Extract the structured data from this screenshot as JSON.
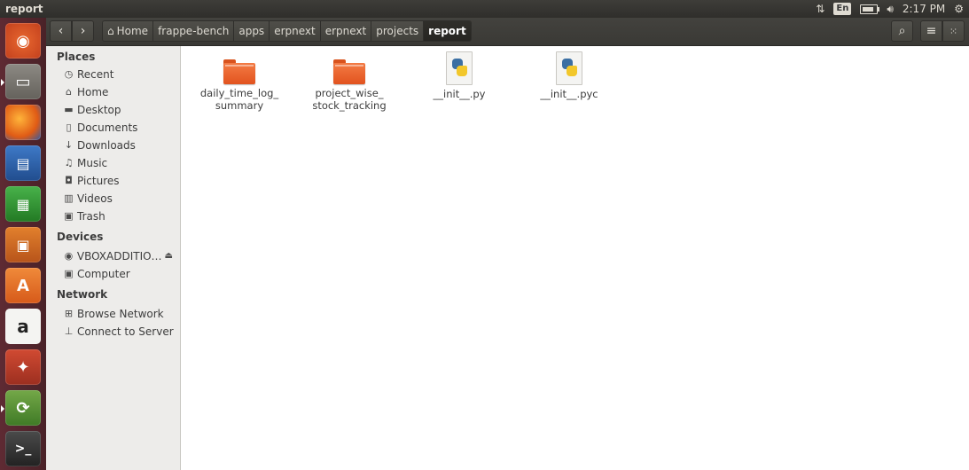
{
  "panel": {
    "title": "report",
    "lang": "En",
    "clock": "2:17 PM"
  },
  "toolbar": {
    "path": [
      "Home",
      "frappe-bench",
      "apps",
      "erpnext",
      "erpnext",
      "projects",
      "report"
    ]
  },
  "sidebar": {
    "places_heading": "Places",
    "places": [
      "Recent",
      "Home",
      "Desktop",
      "Documents",
      "Downloads",
      "Music",
      "Pictures",
      "Videos",
      "Trash"
    ],
    "devices_heading": "Devices",
    "devices": [
      "VBOXADDITIO…",
      "Computer"
    ],
    "network_heading": "Network",
    "network": [
      "Browse Network",
      "Connect to Server"
    ]
  },
  "files": [
    {
      "name": "daily_time_log_\nsummary",
      "type": "folder"
    },
    {
      "name": "project_wise_\nstock_tracking",
      "type": "folder"
    },
    {
      "name": "__init__.py",
      "type": "python"
    },
    {
      "name": "__init__.pyc",
      "type": "python"
    }
  ],
  "colors": {
    "accent": "#e2531f",
    "panel": "#3c3b37",
    "launcher": "#5e2a33"
  }
}
